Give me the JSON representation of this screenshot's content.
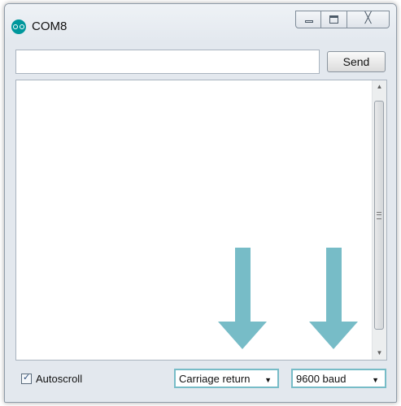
{
  "window": {
    "title": "COM8",
    "icon": "arduino-infinity-icon",
    "controls": {
      "minimize_icon": "minimize-icon",
      "maximize_icon": "maximize-icon",
      "close_icon": "close-icon",
      "close_glyph": "╳"
    }
  },
  "input": {
    "value": "",
    "placeholder": "",
    "send_label": "Send"
  },
  "output": {
    "text": "",
    "scroll_up_glyph": "▲",
    "scroll_down_glyph": "▼"
  },
  "annotations": {
    "arrow_color": "#77bcc7"
  },
  "bottom_bar": {
    "autoscroll_label": "Autoscroll",
    "autoscroll_checked": true,
    "check_glyph": "✓",
    "line_ending": {
      "selected": "Carriage return",
      "caret": "▼"
    },
    "baud_rate": {
      "selected": "9600 baud",
      "caret": "▼"
    }
  }
}
